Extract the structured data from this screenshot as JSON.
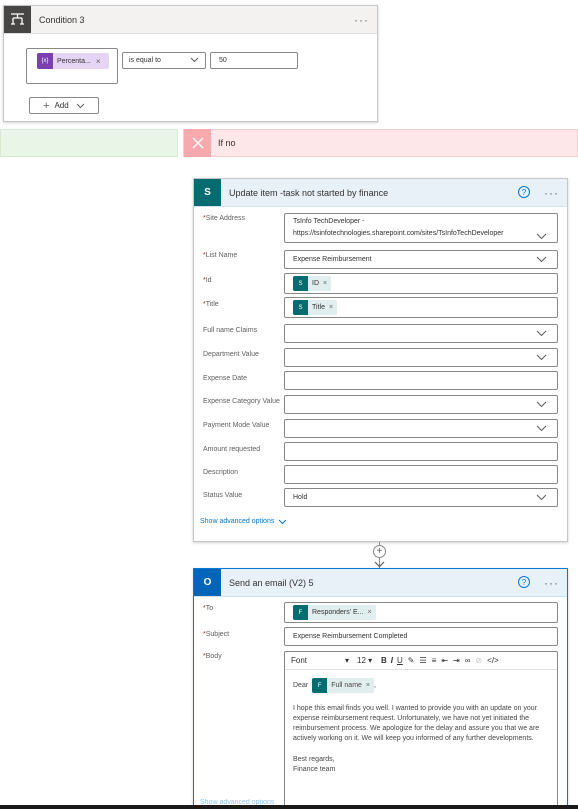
{
  "condition": {
    "title": "Condition 3",
    "menu": "···",
    "token_label": "Percenta...",
    "token_icon": "{x}",
    "token_remove": "×",
    "operator": "is equal to",
    "value": "50",
    "add_label": "Add"
  },
  "branch": {
    "no_label": "If no"
  },
  "update_item": {
    "title": "Update item -task not started by finance",
    "help": "?",
    "menu": "···",
    "site_label": "Site Address",
    "site_line1": "TsInfo TechDeveloper -",
    "site_line2": "https://tsinfotechnologies.sharepoint.com/sites/TsInfoTechDeveloper",
    "list_label": "List Name",
    "list_value": "Expense Reimbursement",
    "id_label": "Id",
    "id_token": "ID",
    "title_label": "Title",
    "title_token": "Title",
    "token_remove": "×",
    "fullname_label": "Full name Claims",
    "department_label": "Department Value",
    "expense_date_label": "Expense Date",
    "expense_category_label": "Expense Category Value",
    "payment_mode_label": "Payment Mode Value",
    "amount_label": "Amount requested",
    "description_label": "Description",
    "status_label": "Status Value",
    "status_value": "Hold",
    "advanced_link": "Show advanced options"
  },
  "email": {
    "title": "Send an email (V2) 5",
    "help": "?",
    "menu": "···",
    "to_label": "To",
    "to_token": "Responders' E...",
    "subject_label": "Subject",
    "subject_value": "Expense Reimbursement Completed",
    "body_label": "Body",
    "font": "Font",
    "size": "12",
    "bold": "B",
    "italic": "I",
    "underline": "U",
    "dear": "Dear",
    "fullname_token": "Full name",
    "comma": ",",
    "paragraph": "I hope this email finds you well. I wanted to provide you with an update on your expense reimbursement request. Unfortunately, we have not yet initiated the reimbursement process. We apologize for the delay and assure you that we are actively working on it. We will keep you informed of any further developments.",
    "regards": "Best regards,",
    "team": "Finance team",
    "cut_link": "Show advanced options"
  }
}
